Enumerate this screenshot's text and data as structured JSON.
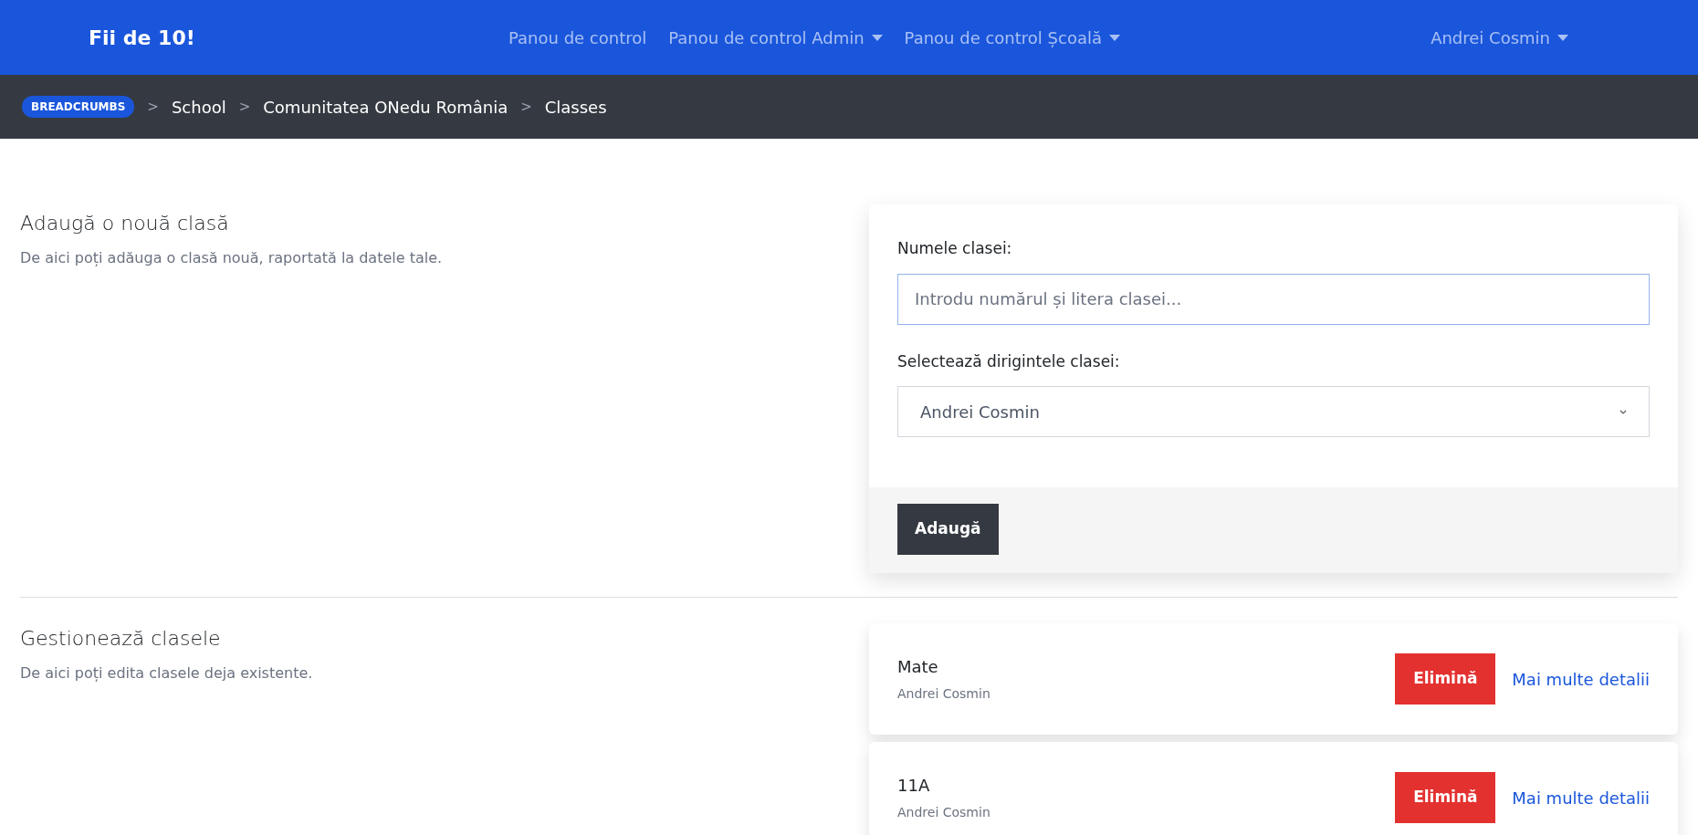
{
  "navbar": {
    "brand": "Fii de 10!",
    "links": [
      {
        "label": "Panou de control",
        "dropdown": false
      },
      {
        "label": "Panou de control Admin",
        "dropdown": true
      },
      {
        "label": "Panou de control Școală",
        "dropdown": true
      }
    ],
    "user": {
      "label": "Andrei Cosmin",
      "dropdown": true
    }
  },
  "breadcrumbs": {
    "badge": "BREADCRUMBS",
    "separator": ">",
    "items": [
      "School",
      "Comunitatea ONedu România",
      "Classes"
    ]
  },
  "add_section": {
    "title": "Adaugă o nouă clasă",
    "description": "De aici poți adăuga o clasă nouă, raportată la datele tale.",
    "form": {
      "name_label": "Numele clasei:",
      "name_placeholder": "Introdu numărul și litera clasei...",
      "teacher_label": "Selectează dirigintele clasei:",
      "teacher_value": "Andrei Cosmin",
      "submit": "Adaugă"
    }
  },
  "manage_section": {
    "title": "Gestionează clasele",
    "description": "De aici poți edita clasele deja existente.",
    "classes": [
      {
        "name": "Mate",
        "teacher": "Andrei Cosmin",
        "delete": "Elimină",
        "details": "Mai multe detalii"
      },
      {
        "name": "11A",
        "teacher": "Andrei Cosmin",
        "delete": "Elimină",
        "details": "Mai multe detalii"
      }
    ]
  }
}
